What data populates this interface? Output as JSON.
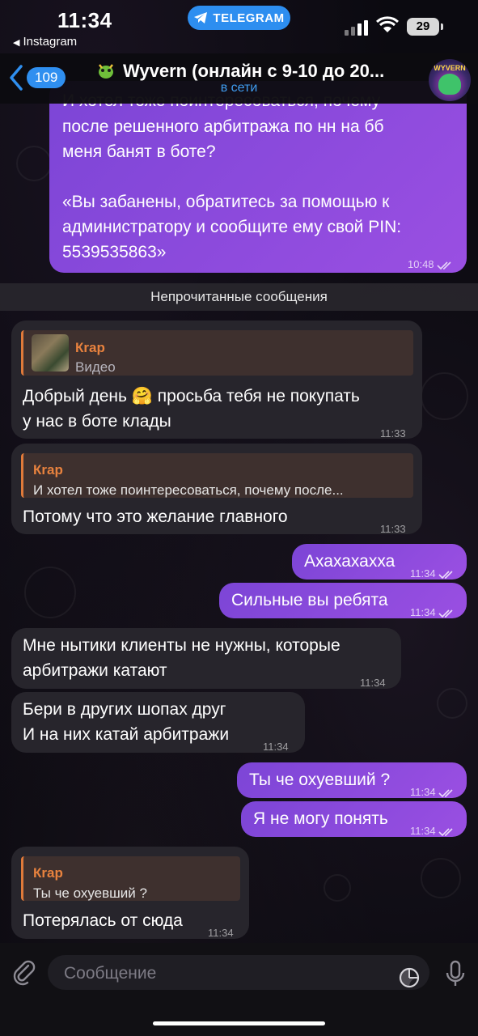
{
  "status_bar": {
    "time": "11:34",
    "back_app": "Instagram",
    "pill_label": "TELEGRAM",
    "battery": "29"
  },
  "header": {
    "unread_count": "109",
    "title": "Wyvern (онлайн с 9-10 до 20...",
    "subtitle": "в сети",
    "avatar_text": "WYVERN"
  },
  "messages": {
    "m0": {
      "line1": "И хотел тоже поинтересоваться, почему",
      "line2": "после решенного арбитража по нн на бб",
      "line3": "меня банят в боте?",
      "line4": "«Вы забанены, обратитесь за помощью к",
      "line5": "администратору  и сообщите ему свой PIN:",
      "line6": "5539535863»",
      "time": "10:48"
    },
    "unread_banner": "Непрочитанные сообщения",
    "m1": {
      "reply_name": "Кrap",
      "reply_text": "Видео",
      "line1": "Добрый день 🤗 просьба тебя не покупать",
      "line2": "у нас в боте клады",
      "time": "11:33"
    },
    "m2": {
      "reply_name": "Кrap",
      "reply_text": "И хотел тоже поинтересоваться, почему после...",
      "line1": "Потому что это желание главного",
      "time": "11:33"
    },
    "m3": {
      "text": "Ахахахахха",
      "time": "11:34"
    },
    "m4": {
      "text": "Сильные вы ребята",
      "time": "11:34"
    },
    "m5": {
      "line1": "Мне нытики клиенты не нужны, которые",
      "line2": "арбитражи катают",
      "time": "11:34"
    },
    "m6": {
      "line1": "Бери в других шопах друг",
      "line2": "И на них катай арбитражи",
      "time": "11:34"
    },
    "m7": {
      "text": "Ты че охуевший ?",
      "time": "11:34"
    },
    "m8": {
      "text": "Я не могу понять",
      "time": "11:34"
    },
    "m9": {
      "reply_name": "Кrap",
      "reply_text": "Ты че охуевший ?",
      "line1": "Потерялась от сюда",
      "time": "11:34"
    }
  },
  "input": {
    "placeholder": "Сообщение"
  },
  "colors": {
    "accent": "#2f8ff0",
    "outgoing": "#8a4ade",
    "incoming": "#27252c",
    "reply_accent": "#e07a3a"
  }
}
